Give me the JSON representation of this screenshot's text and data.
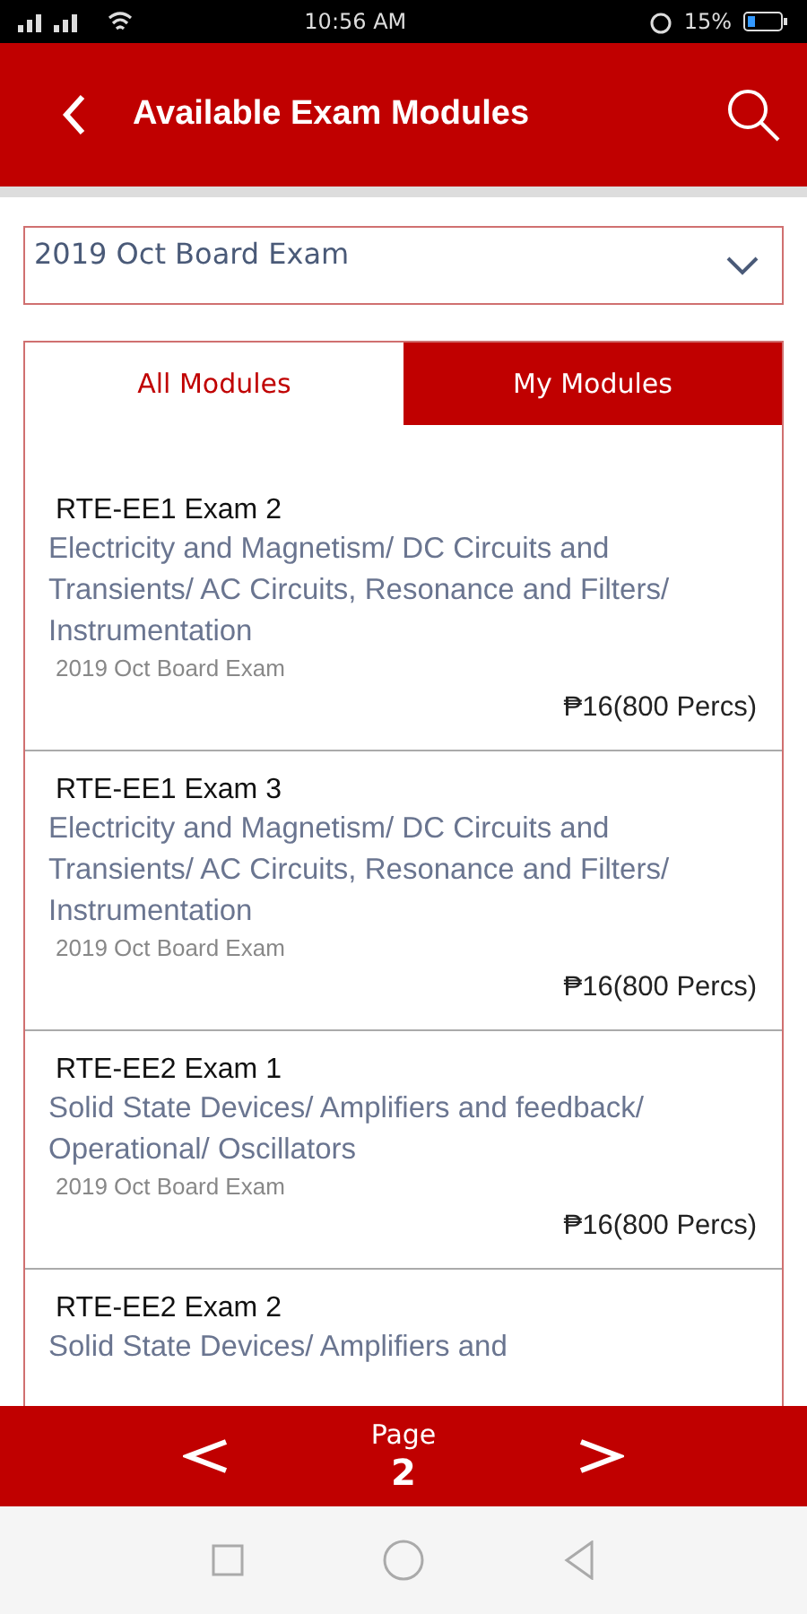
{
  "status_bar": {
    "time": "10:56 AM",
    "battery": "15%"
  },
  "header": {
    "title": "Available Exam Modules"
  },
  "exam_select": {
    "value": "2019 Oct Board Exam"
  },
  "tabs": [
    {
      "label": "All Modules",
      "selected": false
    },
    {
      "label": "My Modules",
      "selected": true
    }
  ],
  "modules": [
    {
      "title": "RTE-EE1 Exam 2",
      "description": "Electricity and Magnetism/ DC Circuits and Transients/ AC Circuits, Resonance and Filters/ Instrumentation",
      "exam": "2019 Oct Board Exam",
      "price": "₱16(800 Percs)"
    },
    {
      "title": "RTE-EE1 Exam 3",
      "description": "Electricity and Magnetism/ DC Circuits and Transients/ AC Circuits, Resonance and Filters/ Instrumentation",
      "exam": "2019 Oct Board Exam",
      "price": "₱16(800 Percs)"
    },
    {
      "title": "RTE-EE2 Exam 1",
      "description": "Solid State Devices/ Amplifiers and feedback/ Operational/ Oscillators",
      "exam": "2019 Oct Board Exam",
      "price": "₱16(800 Percs)"
    },
    {
      "title": "RTE-EE2 Exam 2",
      "description": "Solid State Devices/ Amplifiers and"
    }
  ],
  "pager": {
    "label": "Page",
    "page": "2"
  }
}
